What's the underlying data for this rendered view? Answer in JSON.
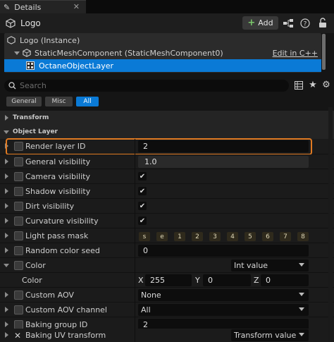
{
  "tab": {
    "title": "Details"
  },
  "header": {
    "actor_name": "Logo",
    "add_label": "Add"
  },
  "tree": {
    "items": [
      {
        "label": "Logo (Instance)"
      },
      {
        "label": "StaticMeshComponent (StaticMeshComponent0)",
        "link": "Edit in C++"
      },
      {
        "label": "OctaneObjectLayer"
      }
    ]
  },
  "search": {
    "placeholder": "Search"
  },
  "filters": [
    {
      "label": "General",
      "active": false
    },
    {
      "label": "Misc",
      "active": false
    },
    {
      "label": "All",
      "active": true
    }
  ],
  "sections": {
    "transform": "Transform",
    "object_layer": "Object Layer"
  },
  "properties": {
    "render_layer_id": {
      "label": "Render layer ID",
      "value": "2"
    },
    "general_visibility": {
      "label": "General visibility",
      "value": "1.0"
    },
    "camera_visibility": {
      "label": "Camera visibility",
      "checked": true
    },
    "shadow_visibility": {
      "label": "Shadow visibility",
      "checked": true
    },
    "dirt_visibility": {
      "label": "Dirt visibility",
      "checked": true
    },
    "curvature_visibility": {
      "label": "Curvature visibility",
      "checked": true
    },
    "light_pass_mask": {
      "label": "Light pass mask",
      "slots": [
        "s",
        "e",
        "1",
        "2",
        "3",
        "4",
        "5",
        "6",
        "7",
        "8"
      ]
    },
    "random_color_seed": {
      "label": "Random color seed",
      "value": "0"
    },
    "color": {
      "label": "Color",
      "mode": "Int value",
      "sub_label": "Color",
      "x": "255",
      "y": "0",
      "z": "0"
    },
    "custom_aov": {
      "label": "Custom AOV",
      "value": "None"
    },
    "custom_aov_channel": {
      "label": "Custom AOV channel",
      "value": "All"
    },
    "baking_group_id": {
      "label": "Baking group ID",
      "value": "2"
    },
    "baking_uv_transform": {
      "label": "Baking UV transform",
      "value": "Transform value"
    }
  },
  "colors": {
    "accent": "#0a7ad6",
    "highlight": "#e07a22",
    "panel": "#1b1b1b"
  }
}
